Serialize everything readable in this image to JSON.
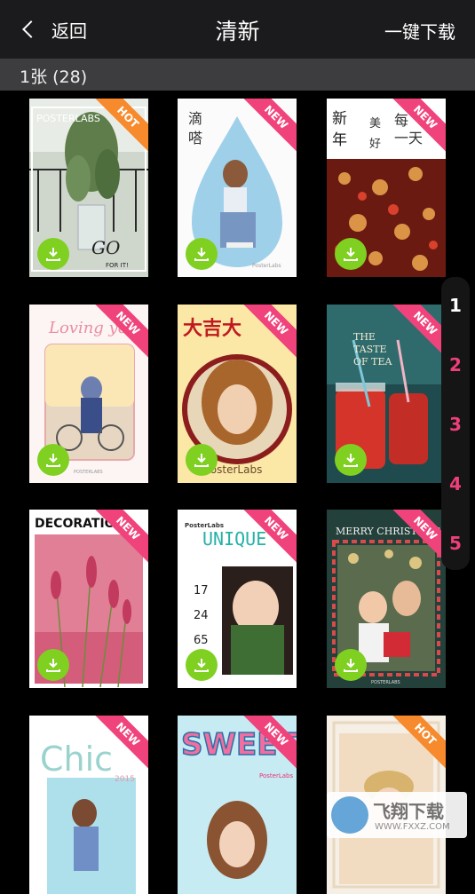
{
  "header": {
    "back_label": "返回",
    "title": "清新",
    "download_all": "一键下载"
  },
  "subbar": {
    "count": "1张 (28)"
  },
  "cards": [
    {
      "badge": "HOT",
      "text": "POSTERLABS",
      "sub": "GO FOR IT!"
    },
    {
      "badge": "NEW",
      "text": "滴嗒",
      "sub": ""
    },
    {
      "badge": "NEW",
      "text": "新 年  每一天",
      "sub": "美 好"
    },
    {
      "badge": "NEW",
      "text": "Loving you",
      "sub": "POSTERLABS"
    },
    {
      "badge": "NEW",
      "text": "大吉大",
      "sub": "PosterLabs"
    },
    {
      "badge": "NEW",
      "text": "THE TASTE OF TEA",
      "sub": ""
    },
    {
      "badge": "NEW",
      "text": "DECORATION",
      "sub": ""
    },
    {
      "badge": "NEW",
      "text": "UNIQUE",
      "sub": "17 24 65",
      "brand": "PosterLabs"
    },
    {
      "badge": "NEW",
      "text": "MERRY CHRISTMAS",
      "sub": "POSTERLABS"
    },
    {
      "badge": "NEW",
      "text": "Chic",
      "sub": "2015"
    },
    {
      "badge": "NEW",
      "text": "SWEET",
      "sub": ""
    },
    {
      "badge": "HOT",
      "text": "",
      "sub": ""
    }
  ],
  "pager": [
    "1",
    "2",
    "3",
    "4",
    "5"
  ],
  "pager_active": "1",
  "watermark": {
    "text": "飞翔下载",
    "url": "WWW.FXXZ.COM"
  },
  "colors": {
    "accent_new": "#f0437c",
    "accent_hot": "#f68a2d",
    "download_green": "#7fd021"
  }
}
